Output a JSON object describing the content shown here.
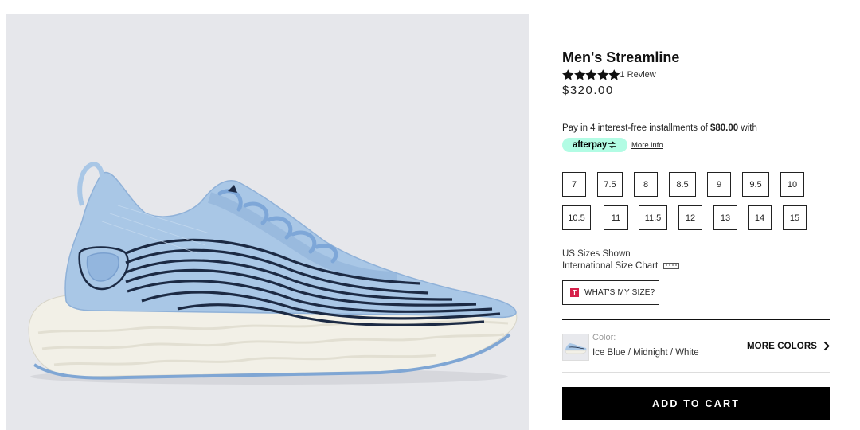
{
  "product": {
    "title": "Men's Streamline",
    "rating": 5,
    "review_count_label": "1 Review",
    "price": "$320.00",
    "image_icon": "shoe-image"
  },
  "afterpay": {
    "line_prefix": "Pay in 4 interest-free installments of ",
    "installment": "$80.00",
    "line_suffix": " with",
    "badge_label": "afterpay",
    "more_info": "More info",
    "badge_color": "#b2fce4"
  },
  "sizes": {
    "row1": [
      "7",
      "7.5",
      "8",
      "8.5",
      "9",
      "9.5",
      "10"
    ],
    "row2": [
      "10.5",
      "11",
      "11.5",
      "12",
      "13",
      "14",
      "15"
    ],
    "note": "US Sizes Shown",
    "chart_label": "International Size Chart",
    "whats_my_size": "WHAT'S MY SIZE?"
  },
  "color": {
    "label": "Color:",
    "value": "Ice Blue / Midnight / White",
    "more_colors": "MORE COLORS"
  },
  "cart": {
    "add_label": "ADD TO CART"
  },
  "colors": {
    "accent": "#000000",
    "shoe_upper": "#a9c7e6",
    "shoe_sole": "#f1efe6",
    "stripes": "#1c2a44",
    "true_fit": "#d6204a"
  }
}
